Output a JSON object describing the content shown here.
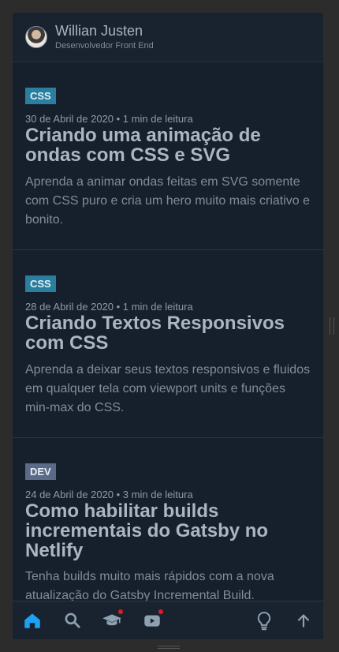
{
  "header": {
    "name": "Willian Justen",
    "role": "Desenvolvedor Front End"
  },
  "posts": [
    {
      "tag": "CSS",
      "tag_color": "#2a7f9e",
      "date": "30 de Abril de 2020 • 1 min de leitura",
      "title": "Criando uma animação de ondas com CSS e SVG",
      "description": "Aprenda a animar ondas feitas em SVG somente com CSS puro e cria um hero muito mais criativo e bonito."
    },
    {
      "tag": "CSS",
      "tag_color": "#2a7f9e",
      "date": "28 de Abril de 2020 • 1 min de leitura",
      "title": "Criando Textos Responsivos com CSS",
      "description": "Aprenda a deixar seus textos responsivos e fluidos em qualquer tela com viewport units e funções min-max do CSS."
    },
    {
      "tag": "DEV",
      "tag_color": "#5b6a86",
      "date": "24 de Abril de 2020 • 3 min de leitura",
      "title": "Como habilitar builds incrementais do Gatsby no Netlify",
      "description": "Tenha builds muito mais rápidos com a nova atualização do Gatsby Incremental Build."
    }
  ],
  "bottom_nav": {
    "items": [
      "home-icon",
      "search-icon",
      "graduation-cap-icon",
      "youtube-icon",
      "lightbulb-icon",
      "arrow-up-icon"
    ],
    "active_color": "#1fa1f2",
    "icon_color": "#8fa0b1",
    "badge_color": "#e01b24"
  }
}
